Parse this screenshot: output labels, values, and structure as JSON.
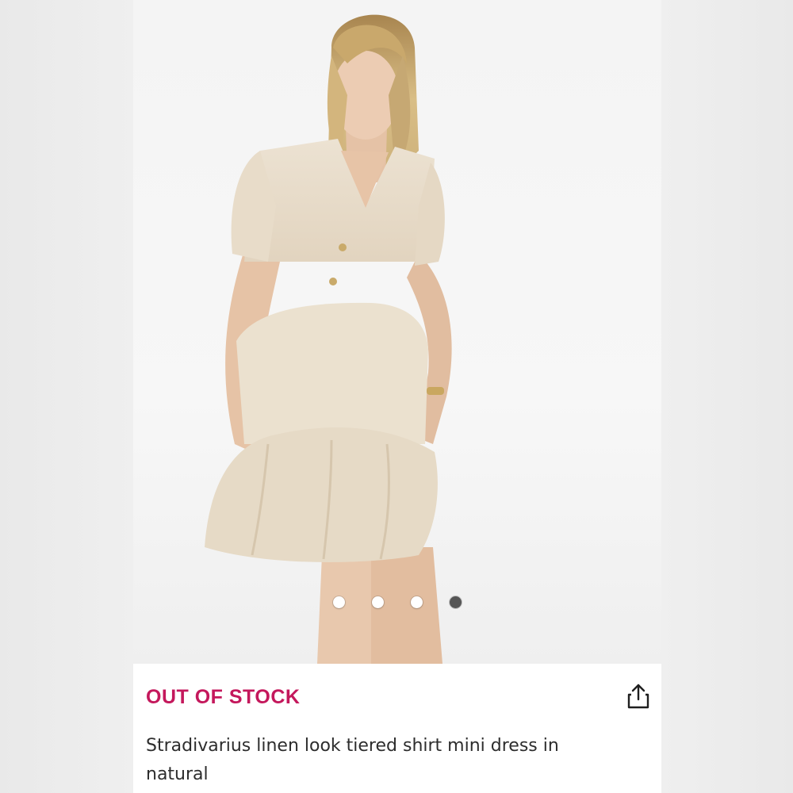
{
  "product": {
    "stock_status": "OUT OF STOCK",
    "title": "Stradivarius linen look tiered shirt mini dress in natural",
    "share_icon": "share-icon"
  },
  "gallery": {
    "image_count": 4,
    "active_index": 3,
    "image_alt": "Model wearing natural linen look tiered shirt mini dress"
  },
  "colors": {
    "stock_status": "#c4185c",
    "dot_active": "#555555",
    "dot_inactive": "#ffffff"
  }
}
